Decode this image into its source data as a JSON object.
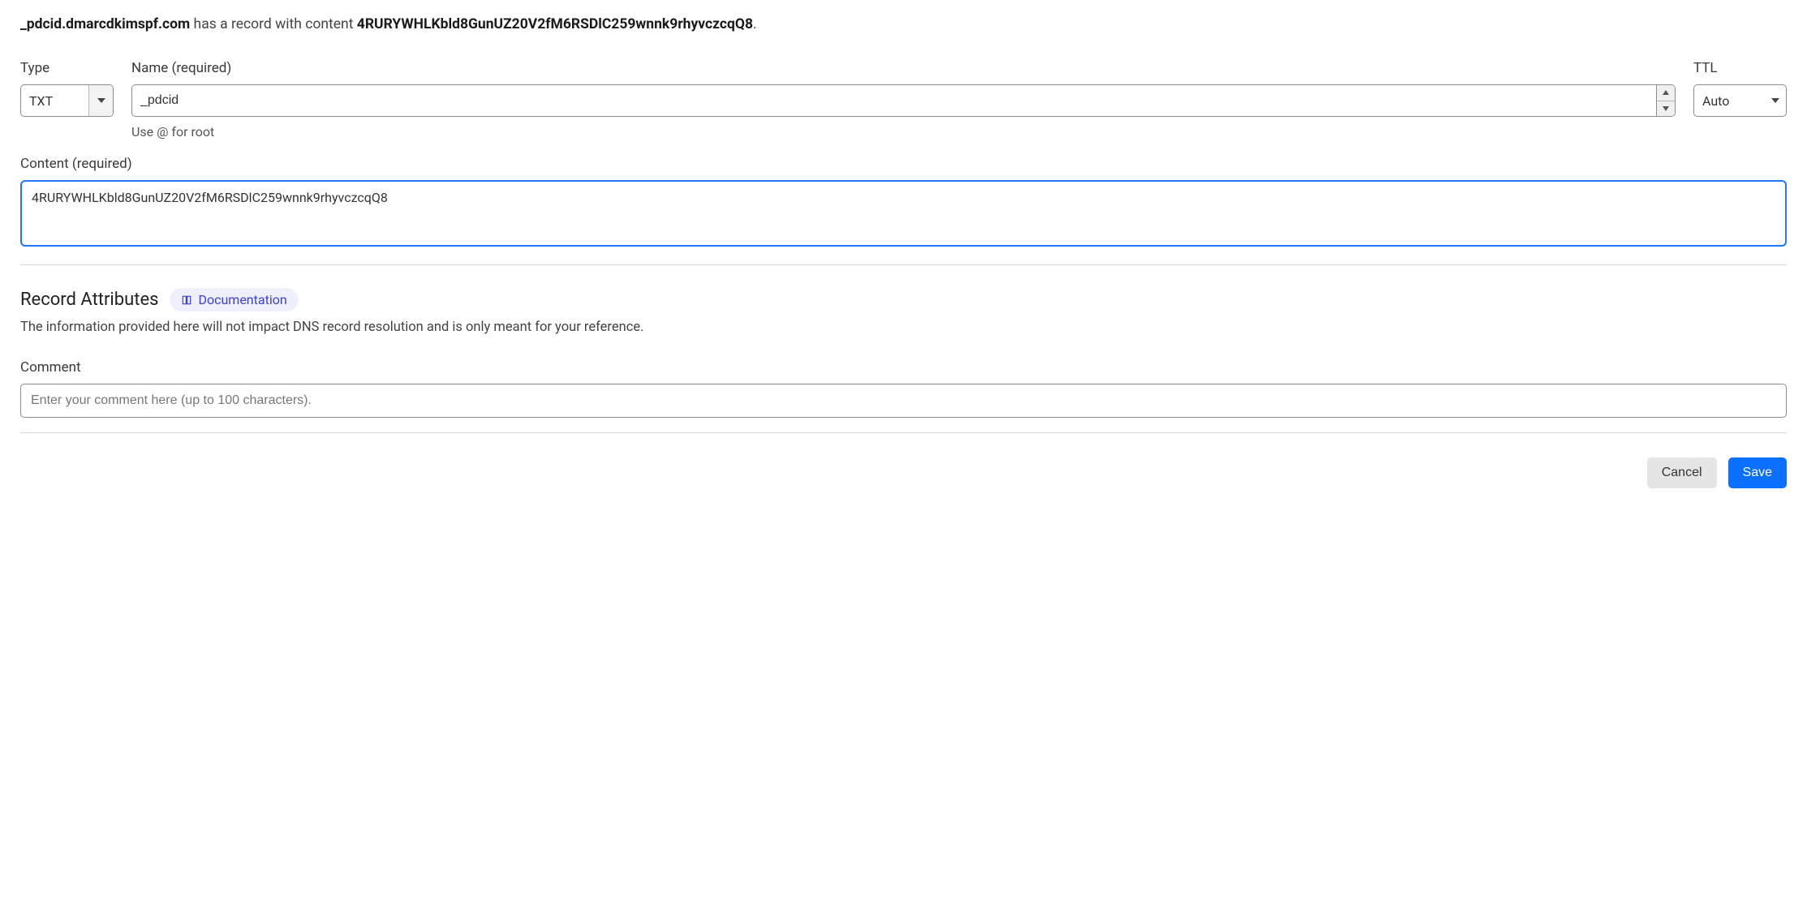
{
  "header": {
    "hostname": "_pdcid.dmarcdkimspf.com",
    "mid_text": " has a record with content ",
    "content_value": "4RURYWHLKbld8GunUZ20V2fM6RSDlC259wnnk9rhyvczcqQ8",
    "period": "."
  },
  "form": {
    "type": {
      "label": "Type",
      "value": "TXT"
    },
    "name": {
      "label": "Name (required)",
      "value": "_pdcid",
      "helper": "Use @ for root"
    },
    "ttl": {
      "label": "TTL",
      "value": "Auto"
    },
    "content": {
      "label": "Content (required)",
      "value": "4RURYWHLKbld8GunUZ20V2fM6RSDlC259wnnk9rhyvczcqQ8"
    }
  },
  "attributes": {
    "title": "Record Attributes",
    "doc_label": "Documentation",
    "description": "The information provided here will not impact DNS record resolution and is only meant for your reference.",
    "comment": {
      "label": "Comment",
      "placeholder": "Enter your comment here (up to 100 characters)."
    }
  },
  "buttons": {
    "cancel": "Cancel",
    "save": "Save"
  }
}
